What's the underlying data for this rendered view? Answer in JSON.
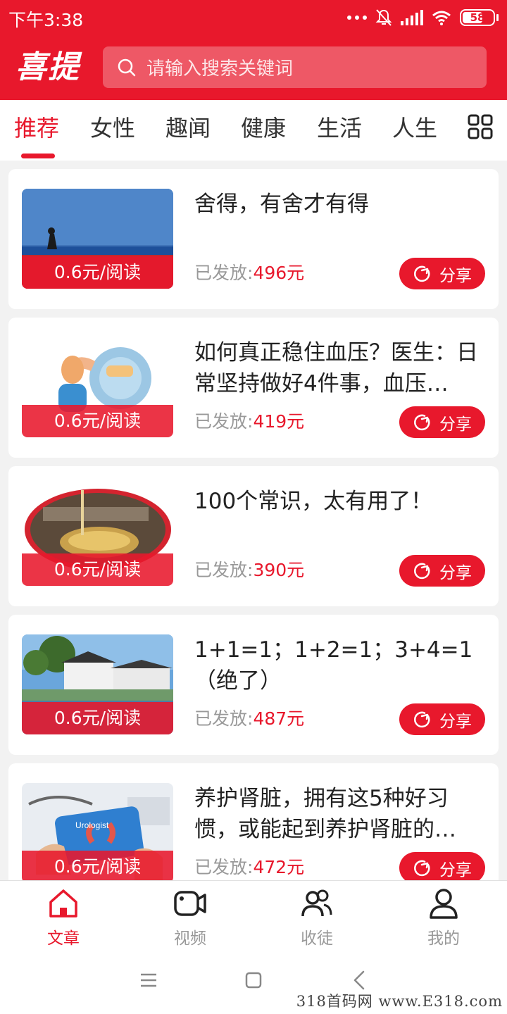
{
  "status_bar": {
    "time": "下午3:38",
    "battery": "58"
  },
  "header": {
    "logo": "喜提",
    "search_placeholder": "请输入搜索关键词"
  },
  "tabs": [
    {
      "label": "推荐",
      "active": true
    },
    {
      "label": "女性"
    },
    {
      "label": "趣闻"
    },
    {
      "label": "健康"
    },
    {
      "label": "生活"
    },
    {
      "label": "人生"
    }
  ],
  "articles": [
    {
      "title": "舍得，有舍才有得",
      "rate": "0.6元/阅读",
      "paid_label": "已发放:",
      "amount": "496元",
      "share": "分享"
    },
    {
      "title": "如何真正稳住血压？医生：日常坚持做好4件事，血压…",
      "rate": "0.6元/阅读",
      "paid_label": "已发放:",
      "amount": "419元",
      "share": "分享"
    },
    {
      "title": "100个常识，太有用了！",
      "rate": "0.6元/阅读",
      "paid_label": "已发放:",
      "amount": "390元",
      "share": "分享"
    },
    {
      "title": "1+1=1；1+2=1；3+4=1（绝了）",
      "rate": "0.6元/阅读",
      "paid_label": "已发放:",
      "amount": "487元",
      "share": "分享"
    },
    {
      "title": "养护肾脏，拥有这5种好习惯，或能起到养护肾脏的…",
      "rate": "0.6元/阅读",
      "paid_label": "已发放:",
      "amount": "472元",
      "share": "分享",
      "thumb_text": "Urologist"
    }
  ],
  "bottom_nav": [
    {
      "label": "文章",
      "active": true
    },
    {
      "label": "视频"
    },
    {
      "label": "收徒"
    },
    {
      "label": "我的"
    }
  ],
  "watermark": "318首码网 www.E318.com",
  "colors": {
    "brand": "#e8182c",
    "muted": "#999999"
  }
}
